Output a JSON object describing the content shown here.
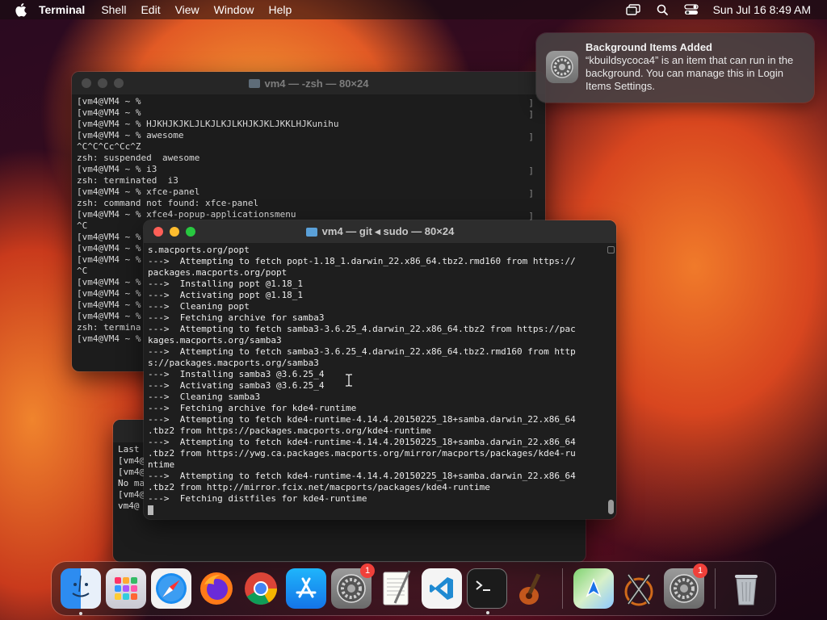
{
  "menubar": {
    "app_name": "Terminal",
    "items": [
      "Shell",
      "Edit",
      "View",
      "Window",
      "Help"
    ],
    "clock": "Sun Jul 16  8:49 AM"
  },
  "notification": {
    "title": "Background Items Added",
    "body": "“kbuildsycoca4” is an item that can run in the background. You can manage this in Login Items Settings."
  },
  "term_back": {
    "title": "vm4 — -zsh — 80×24",
    "lines": [
      "[vm4@VM4 ~ %",
      "[vm4@VM4 ~ %",
      "[vm4@VM4 ~ % HJKHJKJKLJLKJLKJLKHJKJKLJKKLHJKunihu",
      "[vm4@VM4 ~ % awesome",
      "^C^C^Cc^Cc^Z",
      "zsh: suspended  awesome",
      "[vm4@VM4 ~ % i3",
      "zsh: terminated  i3",
      "[vm4@VM4 ~ % xfce-panel",
      "zsh: command not found: xfce-panel",
      "[vm4@VM4 ~ % xfce4-popup-applicationsmenu",
      "^C",
      "[vm4@VM4 ~ %",
      "[vm4@VM4 ~ %",
      "[vm4@VM4 ~ %",
      "^C",
      "[vm4@VM4 ~ %",
      "[vm4@VM4 ~ %",
      "[vm4@VM4 ~ %",
      "[vm4@VM4 ~ %",
      "zsh: termina",
      "[vm4@VM4 ~ %"
    ]
  },
  "term_small": {
    "lines": [
      "Last",
      "[vm4@",
      "[vm4@",
      "No ma",
      "[vm4@",
      "vm4@"
    ]
  },
  "term_front": {
    "title": "vm4 — git ◂ sudo — 80×24",
    "lines": [
      "s.macports.org/popt",
      "--->  Attempting to fetch popt-1.18_1.darwin_22.x86_64.tbz2.rmd160 from https://",
      "packages.macports.org/popt",
      "--->  Installing popt @1.18_1",
      "--->  Activating popt @1.18_1",
      "--->  Cleaning popt",
      "--->  Fetching archive for samba3",
      "--->  Attempting to fetch samba3-3.6.25_4.darwin_22.x86_64.tbz2 from https://pac",
      "kages.macports.org/samba3",
      "--->  Attempting to fetch samba3-3.6.25_4.darwin_22.x86_64.tbz2.rmd160 from http",
      "s://packages.macports.org/samba3",
      "--->  Installing samba3 @3.6.25_4",
      "--->  Activating samba3 @3.6.25_4",
      "--->  Cleaning samba3",
      "--->  Fetching archive for kde4-runtime",
      "--->  Attempting to fetch kde4-runtime-4.14.4.20150225_18+samba.darwin_22.x86_64",
      ".tbz2 from https://packages.macports.org/kde4-runtime",
      "--->  Attempting to fetch kde4-runtime-4.14.4.20150225_18+samba.darwin_22.x86_64",
      ".tbz2 from https://ywg.ca.packages.macports.org/mirror/macports/packages/kde4-ru",
      "ntime",
      "--->  Attempting to fetch kde4-runtime-4.14.4.20150225_18+samba.darwin_22.x86_64",
      ".tbz2 from http://mirror.fcix.net/macports/packages/kde4-runtime",
      "--->  Fetching distfiles for kde4-runtime"
    ]
  },
  "dock": {
    "items": [
      {
        "name": "finder",
        "running": true
      },
      {
        "name": "launchpad"
      },
      {
        "name": "safari"
      },
      {
        "name": "firefox"
      },
      {
        "name": "chrome"
      },
      {
        "name": "app-store"
      },
      {
        "name": "system-settings",
        "badge": "1"
      },
      {
        "name": "textedit"
      },
      {
        "name": "vscode"
      },
      {
        "name": "terminal",
        "running": true
      },
      {
        "name": "garageband"
      },
      {
        "name": "maps"
      },
      {
        "name": "x11"
      },
      {
        "name": "system-settings-2",
        "badge": "1"
      },
      {
        "name": "trash"
      }
    ]
  },
  "colors": {
    "close": "#fe5f57",
    "minimize": "#febc2e",
    "zoom": "#28c840",
    "badge": "#f0403a"
  }
}
